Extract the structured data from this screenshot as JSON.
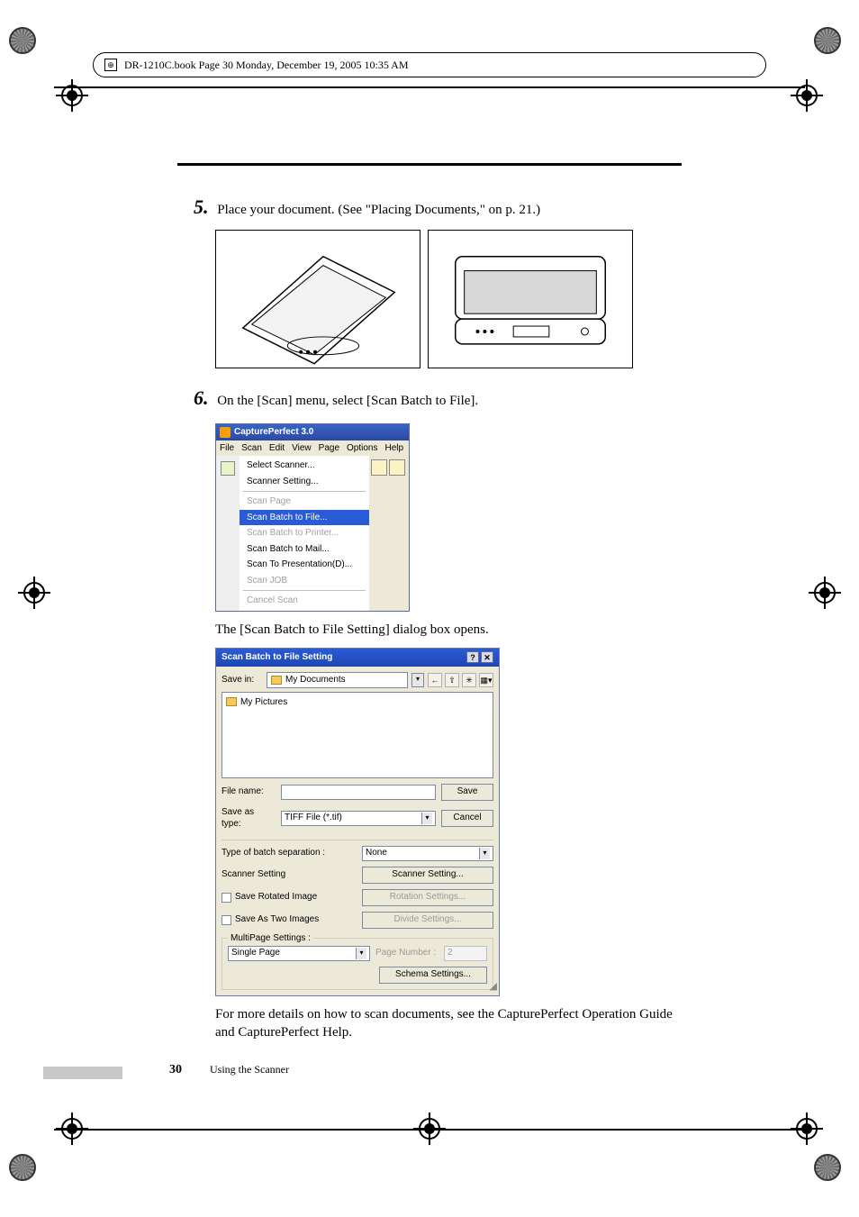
{
  "meta": {
    "header_text": "DR-1210C.book  Page 30  Monday, December 19, 2005  10:35 AM"
  },
  "steps": {
    "s5": {
      "num": "5.",
      "text": "Place your document. (See \"Placing Documents,\" on p. 21.)"
    },
    "s6": {
      "num": "6.",
      "text": "On the [Scan] menu, select [Scan Batch to File]."
    }
  },
  "menu_shot": {
    "title": "CapturePerfect 3.0",
    "menubar": [
      "File",
      "Scan",
      "Edit",
      "View",
      "Page",
      "Options",
      "Help"
    ],
    "items": {
      "select_scanner": "Select Scanner...",
      "scanner_setting": "Scanner Setting...",
      "scan_page": "Scan Page",
      "scan_batch_to_file": "Scan Batch to File...",
      "scan_batch_to_printer": "Scan Batch to Printer...",
      "scan_batch_to_mail": "Scan Batch to Mail...",
      "scan_to_presentation": "Scan To Presentation(D)...",
      "scan_job": "Scan JOB",
      "cancel_scan": "Cancel Scan"
    }
  },
  "caption_after_menu": "The [Scan Batch to File Setting] dialog box opens.",
  "dialog": {
    "title": "Scan Batch to File Setting",
    "savein_label": "Save in:",
    "savein_value": "My Documents",
    "filelist_item": "My Pictures",
    "filename_label": "File name:",
    "filename_value": "",
    "savetype_label": "Save as type:",
    "savetype_value": "TIFF File (*.tif)",
    "save_btn": "Save",
    "cancel_btn": "Cancel",
    "batch_sep_label": "Type of batch separation :",
    "batch_sep_value": "None",
    "scanner_setting_label": "Scanner Setting",
    "scanner_setting_btn": "Scanner Setting...",
    "save_rotated_label": "Save Rotated Image",
    "rotation_btn": "Rotation Settings...",
    "save_two_label": "Save As Two Images",
    "divide_btn": "Divide Settings...",
    "multipage_legend": "MultiPage Settings :",
    "multipage_value": "Single Page",
    "page_number_label": "Page Number :",
    "page_number_value": "2",
    "schema_btn": "Schema Settings..."
  },
  "after_dialog": "For more details on how to scan documents, see the CapturePerfect Operation Guide and CapturePerfect Help.",
  "footer": {
    "page": "30",
    "section": "Using the Scanner"
  }
}
